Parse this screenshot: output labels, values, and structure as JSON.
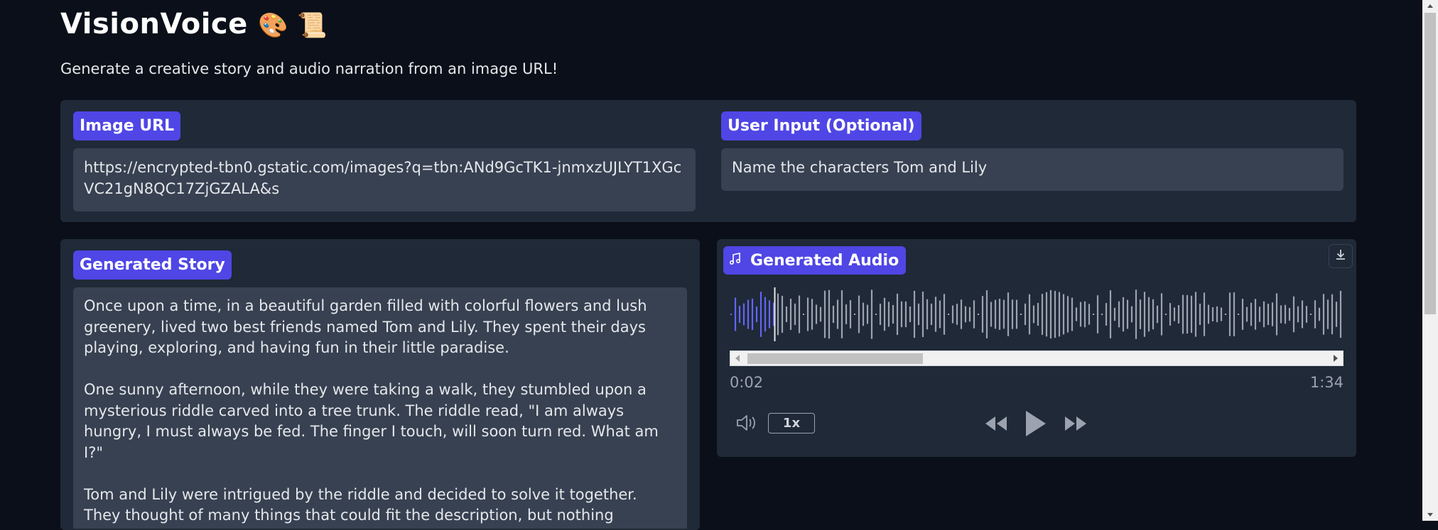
{
  "header": {
    "title": "VisionVoice",
    "title_emoji": "🎨 📜",
    "subtitle": "Generate a creative story and audio narration from an image URL!"
  },
  "inputs": {
    "image_url": {
      "label": "Image URL",
      "value": "https://encrypted-tbn0.gstatic.com/images?q=tbn:ANd9GcTK1-jnmxzUJLYT1XGcVC21gN8QC17ZjGZALA&s"
    },
    "user_input": {
      "label": "User Input (Optional)",
      "value": "Name the characters Tom and Lily"
    }
  },
  "story": {
    "label": "Generated Story",
    "paragraphs": [
      "Once upon a time, in a beautiful garden filled with colorful flowers and lush greenery, lived two best friends named Tom and Lily. They spent their days playing, exploring, and having fun in their little paradise.",
      "One sunny afternoon, while they were taking a walk, they stumbled upon a mysterious riddle carved into a tree trunk. The riddle read, \"I am always hungry, I must always be fed. The finger I touch, will soon turn red. What am I?\"",
      "Tom and Lily were intrigued by the riddle and decided to solve it together. They thought of many things that could fit the description, but nothing"
    ]
  },
  "audio": {
    "label": "Generated Audio",
    "current_time": "0:02",
    "duration": "1:34",
    "playback_rate": "1x",
    "progress": 0.021,
    "icons": {
      "label": "music-note-icon",
      "download": "download-icon",
      "volume": "volume-icon",
      "rewind": "rewind-icon",
      "play": "play-icon",
      "forward": "fast-forward-icon"
    }
  },
  "colors": {
    "background": "#0b0f19",
    "panel": "#1f2937",
    "field": "#374151",
    "accent": "#4f46e5",
    "wave_played": "#6366f1",
    "wave_unplayed": "#9ca3af"
  }
}
